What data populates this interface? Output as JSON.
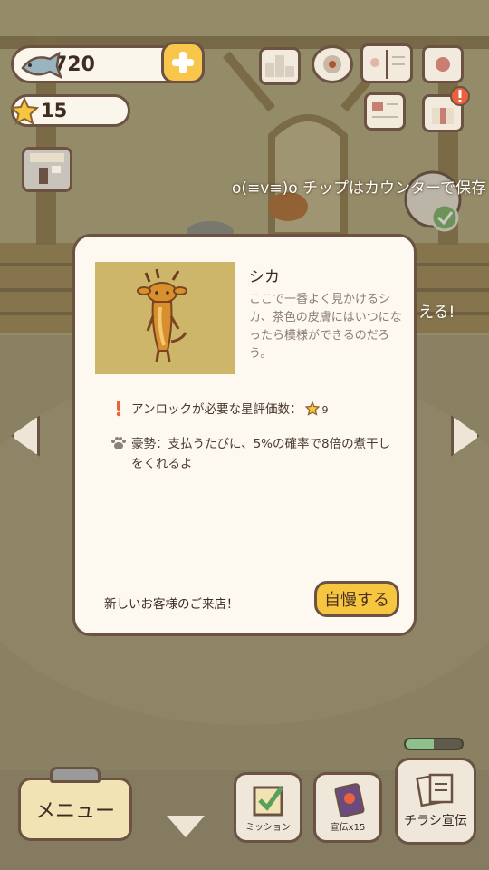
{
  "currency": {
    "fish": "720",
    "stars": "15"
  },
  "marquee": "o(≡v≡)o チップはカウンターで保存",
  "side_text": "える!",
  "dialog": {
    "name": "シカ",
    "description": "ここで一番よく見かけるシカ、茶色の皮膚にはいつになったら模様ができるのだろう。",
    "unlock_label": "アンロックが必要な星評価数：",
    "unlock_stars": "9",
    "perk": "豪勢：支払うたびに、5%の確率で8倍の煮干しをくれるよ",
    "notice": "新しいお客様のご来店！",
    "brag_button": "自慢する"
  },
  "bottom": {
    "menu": "メニュー",
    "mission": "ミッション",
    "promo": "宣伝x15",
    "flyer": "チラシ宣伝"
  },
  "flyer_progress": 0.5,
  "colors": {
    "outline": "#6b5243",
    "button_yellow": "#f6c640",
    "dialog_bg": "#fdf8f0",
    "portrait_bg": "#cdb56a",
    "alert_red": "#e8623c"
  }
}
